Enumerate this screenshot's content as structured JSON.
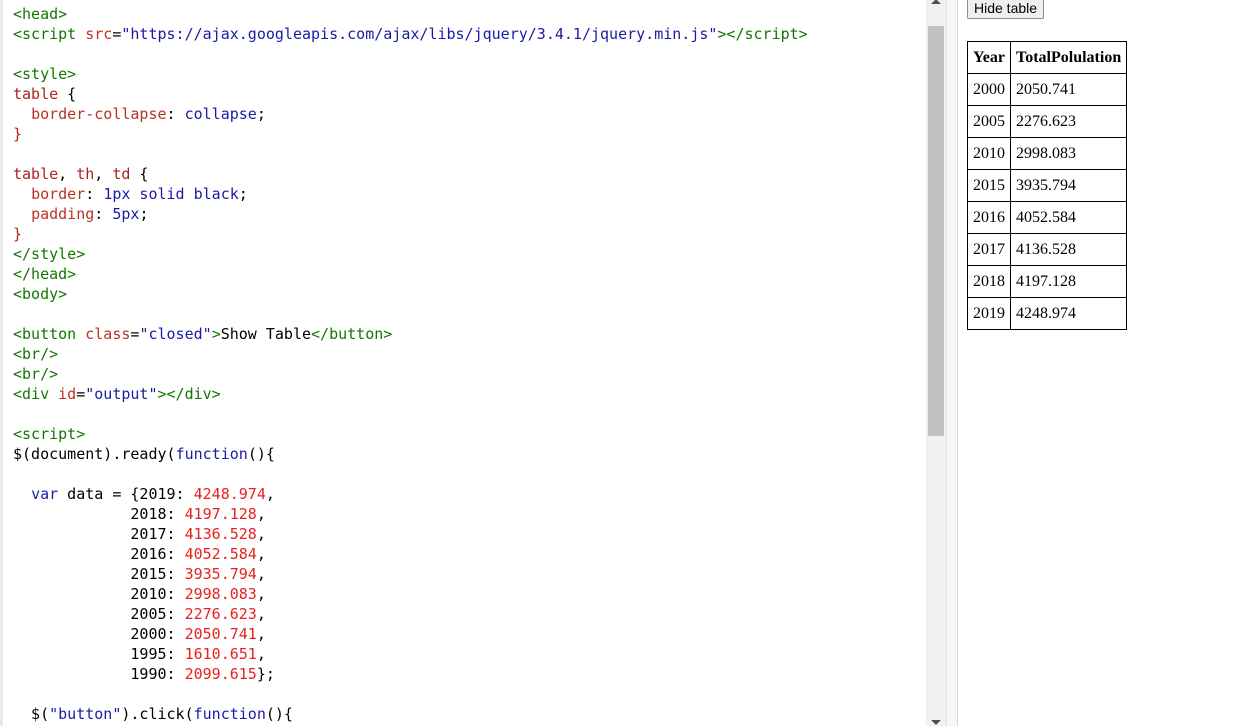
{
  "editor": {
    "lines": [
      [
        {
          "c": "t-tag",
          "t": "<head>"
        }
      ],
      [
        {
          "c": "t-tag",
          "t": "<script "
        },
        {
          "c": "t-attr",
          "t": "src"
        },
        {
          "c": "t-def",
          "t": "="
        },
        {
          "c": "t-str",
          "t": "\"https://ajax.googleapis.com/ajax/libs/jquery/3.4.1/jquery.min.js\""
        },
        {
          "c": "t-tag",
          "t": "></"
        },
        {
          "c": "t-tag",
          "t": "script>"
        }
      ],
      [],
      [
        {
          "c": "t-tag",
          "t": "<style>"
        }
      ],
      [
        {
          "c": "t-sel",
          "t": "table"
        },
        {
          "c": "t-def",
          "t": " {"
        }
      ],
      [
        {
          "c": "t-def",
          "t": "  "
        },
        {
          "c": "t-prop",
          "t": "border-collapse"
        },
        {
          "c": "t-def",
          "t": ": "
        },
        {
          "c": "t-val",
          "t": "collapse"
        },
        {
          "c": "t-def",
          "t": ";"
        }
      ],
      [
        {
          "c": "t-br2",
          "t": "}"
        }
      ],
      [],
      [
        {
          "c": "t-sel",
          "t": "table"
        },
        {
          "c": "t-def",
          "t": ", "
        },
        {
          "c": "t-sel",
          "t": "th"
        },
        {
          "c": "t-def",
          "t": ", "
        },
        {
          "c": "t-sel",
          "t": "td"
        },
        {
          "c": "t-def",
          "t": " {"
        }
      ],
      [
        {
          "c": "t-def",
          "t": "  "
        },
        {
          "c": "t-prop",
          "t": "border"
        },
        {
          "c": "t-def",
          "t": ": "
        },
        {
          "c": "t-val",
          "t": "1px solid black"
        },
        {
          "c": "t-def",
          "t": ";"
        }
      ],
      [
        {
          "c": "t-def",
          "t": "  "
        },
        {
          "c": "t-prop",
          "t": "padding"
        },
        {
          "c": "t-def",
          "t": ": "
        },
        {
          "c": "t-val",
          "t": "5px"
        },
        {
          "c": "t-def",
          "t": ";"
        }
      ],
      [
        {
          "c": "t-br2",
          "t": "}"
        }
      ],
      [
        {
          "c": "t-tag",
          "t": "</style>"
        }
      ],
      [
        {
          "c": "t-tag",
          "t": "</head>"
        }
      ],
      [
        {
          "c": "t-tag",
          "t": "<body>"
        }
      ],
      [],
      [
        {
          "c": "t-tag",
          "t": "<button "
        },
        {
          "c": "t-attr",
          "t": "class"
        },
        {
          "c": "t-def",
          "t": "="
        },
        {
          "c": "t-str",
          "t": "\"closed\""
        },
        {
          "c": "t-tag",
          "t": ">"
        },
        {
          "c": "t-def",
          "t": "Show Table"
        },
        {
          "c": "t-tag",
          "t": "</button>"
        }
      ],
      [
        {
          "c": "t-tag",
          "t": "<br/>"
        }
      ],
      [
        {
          "c": "t-tag",
          "t": "<br/>"
        }
      ],
      [
        {
          "c": "t-tag",
          "t": "<div "
        },
        {
          "c": "t-attr",
          "t": "id"
        },
        {
          "c": "t-def",
          "t": "="
        },
        {
          "c": "t-str",
          "t": "\"output\""
        },
        {
          "c": "t-tag",
          "t": "></div>"
        }
      ],
      [],
      [
        {
          "c": "t-tag",
          "t": "<script>"
        }
      ],
      [
        {
          "c": "t-def",
          "t": "$(document).ready("
        },
        {
          "c": "t-kw",
          "t": "function"
        },
        {
          "c": "t-def",
          "t": "(){"
        }
      ],
      [],
      [
        {
          "c": "t-def",
          "t": "  "
        },
        {
          "c": "t-kw",
          "t": "var"
        },
        {
          "c": "t-def",
          "t": " data = {2019: "
        },
        {
          "c": "t-num",
          "t": "4248.974"
        },
        {
          "c": "t-def",
          "t": ","
        }
      ],
      [
        {
          "c": "t-def",
          "t": "             2018: "
        },
        {
          "c": "t-num",
          "t": "4197.128"
        },
        {
          "c": "t-def",
          "t": ","
        }
      ],
      [
        {
          "c": "t-def",
          "t": "             2017: "
        },
        {
          "c": "t-num",
          "t": "4136.528"
        },
        {
          "c": "t-def",
          "t": ","
        }
      ],
      [
        {
          "c": "t-def",
          "t": "             2016: "
        },
        {
          "c": "t-num",
          "t": "4052.584"
        },
        {
          "c": "t-def",
          "t": ","
        }
      ],
      [
        {
          "c": "t-def",
          "t": "             2015: "
        },
        {
          "c": "t-num",
          "t": "3935.794"
        },
        {
          "c": "t-def",
          "t": ","
        }
      ],
      [
        {
          "c": "t-def",
          "t": "             2010: "
        },
        {
          "c": "t-num",
          "t": "2998.083"
        },
        {
          "c": "t-def",
          "t": ","
        }
      ],
      [
        {
          "c": "t-def",
          "t": "             2005: "
        },
        {
          "c": "t-num",
          "t": "2276.623"
        },
        {
          "c": "t-def",
          "t": ","
        }
      ],
      [
        {
          "c": "t-def",
          "t": "             2000: "
        },
        {
          "c": "t-num",
          "t": "2050.741"
        },
        {
          "c": "t-def",
          "t": ","
        }
      ],
      [
        {
          "c": "t-def",
          "t": "             1995: "
        },
        {
          "c": "t-num",
          "t": "1610.651"
        },
        {
          "c": "t-def",
          "t": ","
        }
      ],
      [
        {
          "c": "t-def",
          "t": "             1990: "
        },
        {
          "c": "t-num",
          "t": "2099.615"
        },
        {
          "c": "t-def",
          "t": "};"
        }
      ],
      [],
      [
        {
          "c": "t-def",
          "t": "  $("
        },
        {
          "c": "t-str",
          "t": "\"button\""
        },
        {
          "c": "t-def",
          "t": ").click("
        },
        {
          "c": "t-kw",
          "t": "function"
        },
        {
          "c": "t-def",
          "t": "(){"
        }
      ]
    ]
  },
  "output": {
    "hide_button_label": "Hide table",
    "table": {
      "headers": [
        "Year",
        "TotalPolulation"
      ],
      "rows": [
        [
          "2000",
          "2050.741"
        ],
        [
          "2005",
          "2276.623"
        ],
        [
          "2010",
          "2998.083"
        ],
        [
          "2015",
          "3935.794"
        ],
        [
          "2016",
          "4052.584"
        ],
        [
          "2017",
          "4136.528"
        ],
        [
          "2018",
          "4197.128"
        ],
        [
          "2019",
          "4248.974"
        ]
      ]
    }
  },
  "colors": {
    "tag": "#117700",
    "attribute": "#bb3322",
    "string": "#1a1aa6",
    "number": "#e8211f",
    "scroll_thumb": "#c1c1c1"
  }
}
